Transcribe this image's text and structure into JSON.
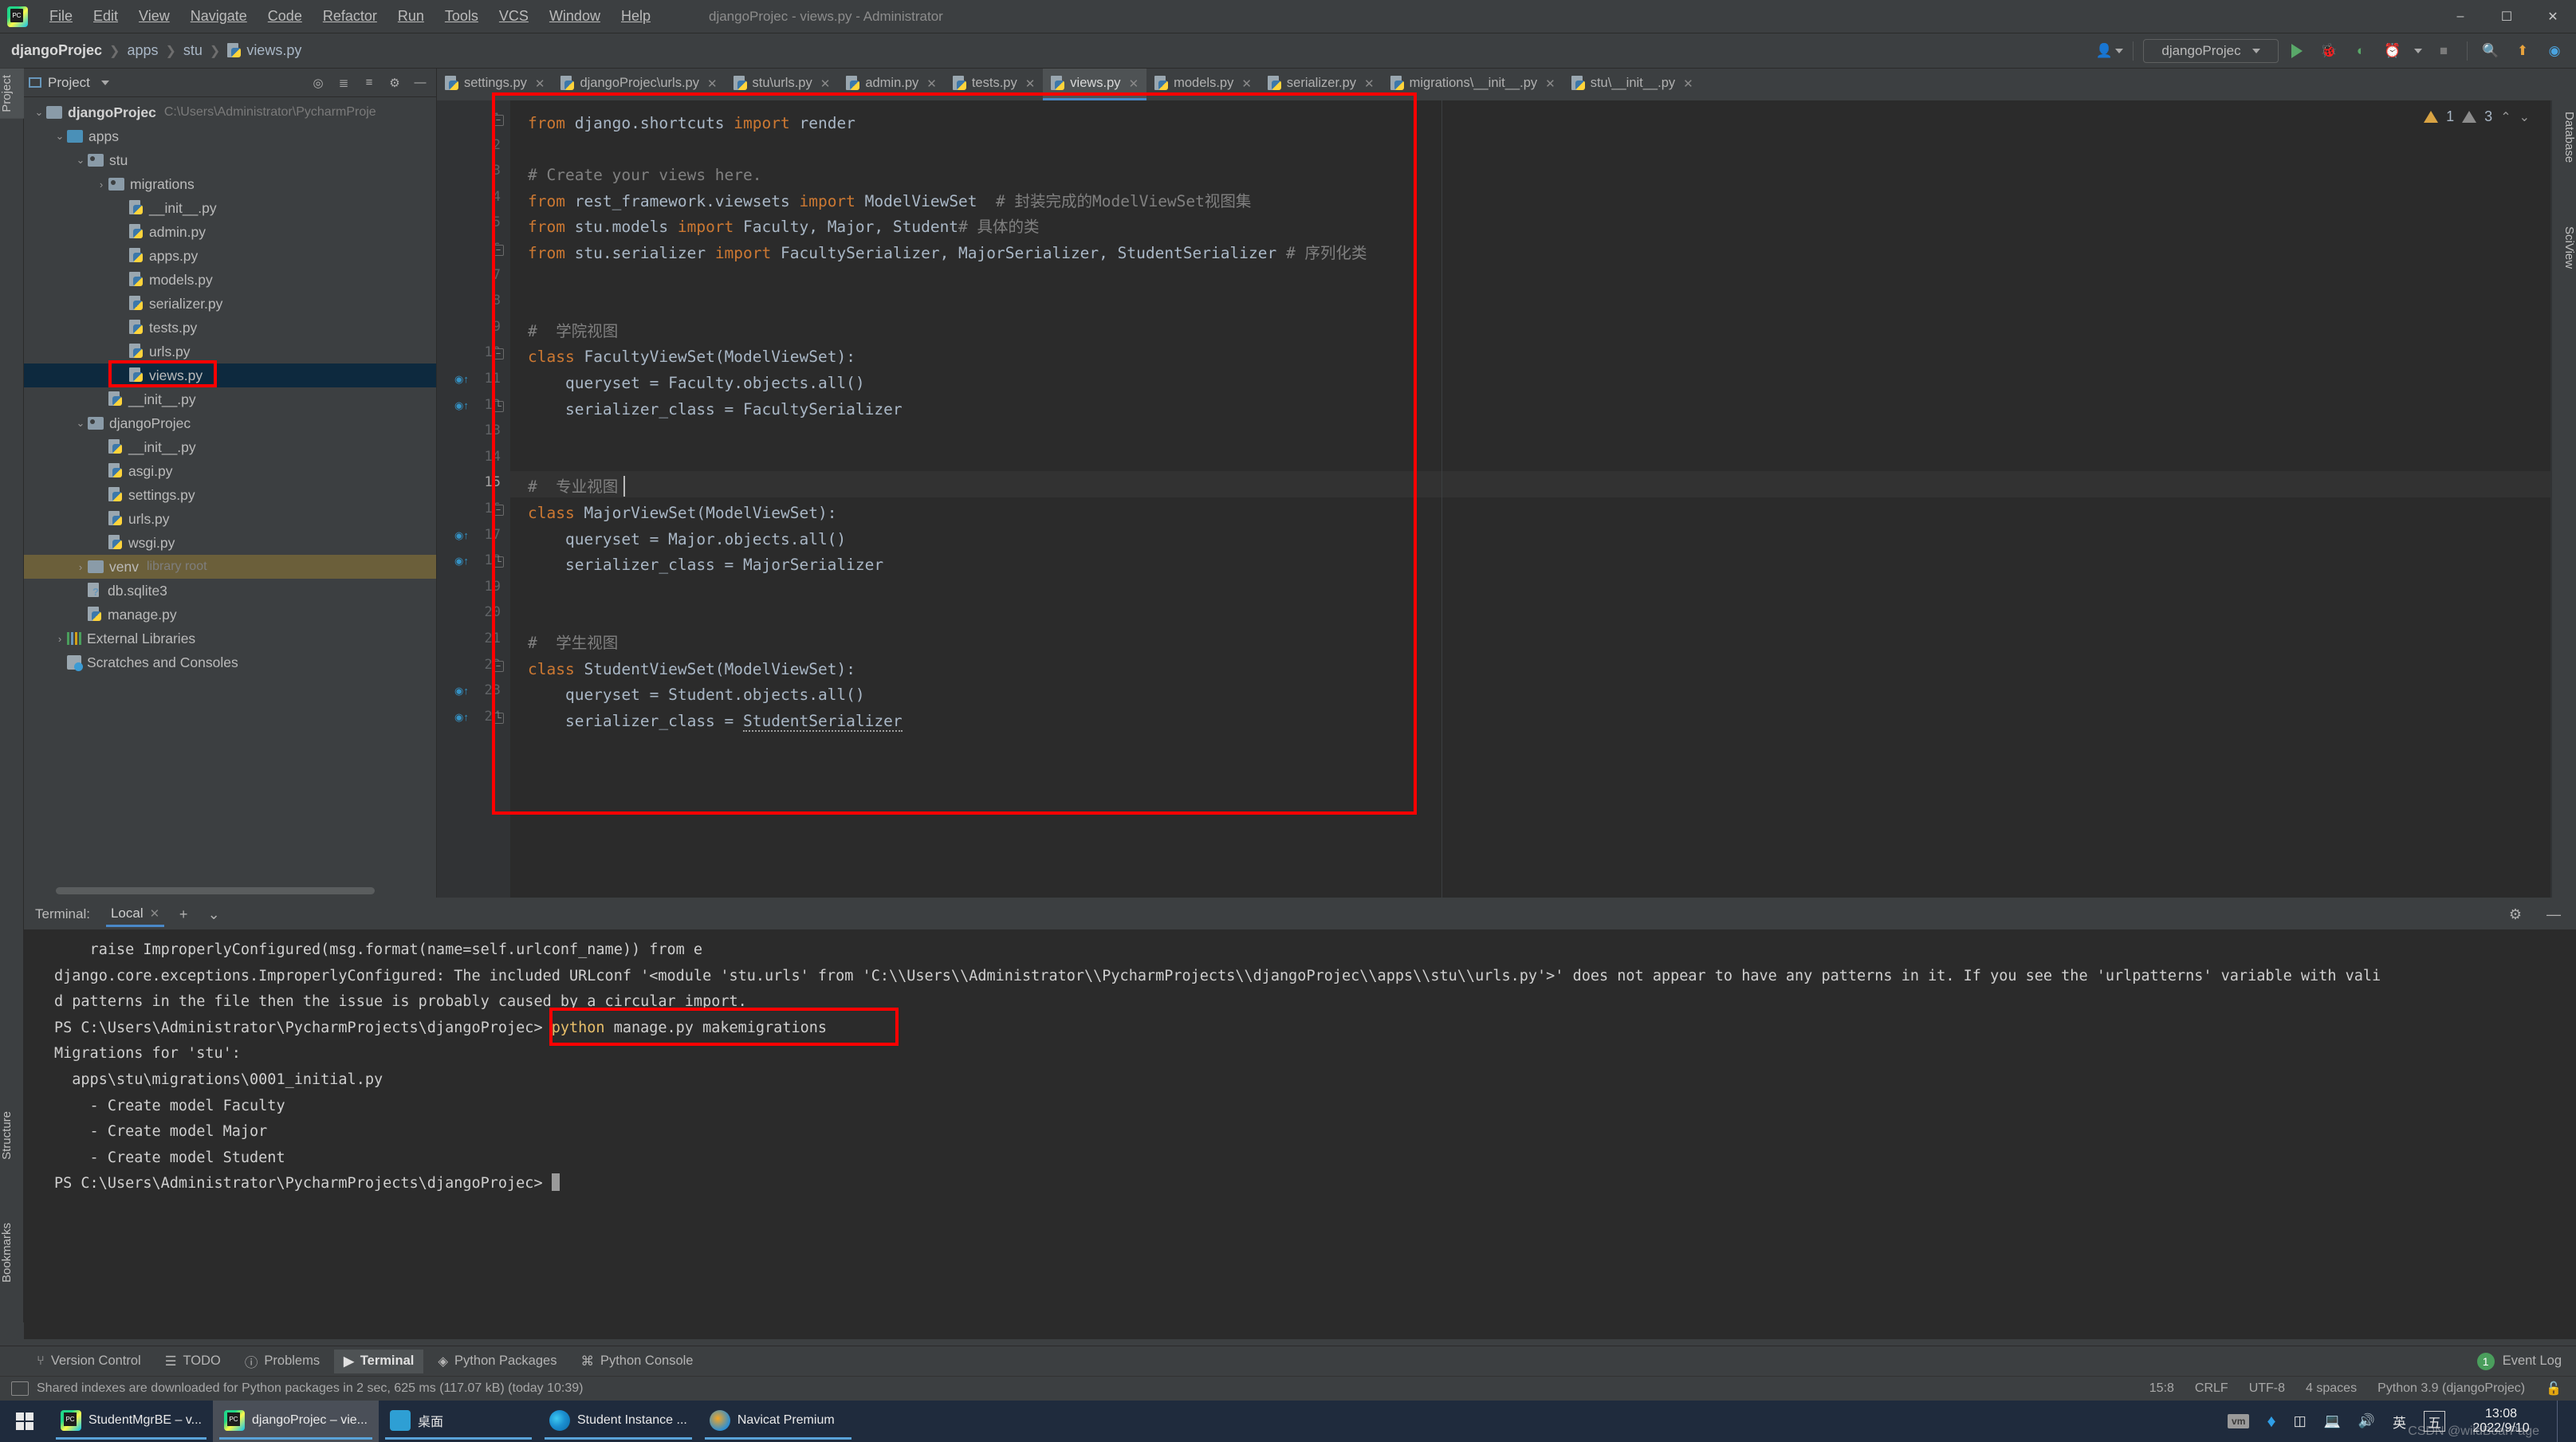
{
  "window": {
    "title": "djangoProjec - views.py - Administrator",
    "app_icon": "pycharm-logo-icon",
    "minimize": "–",
    "maximize": "☐",
    "close": "✕"
  },
  "menubar": [
    {
      "label": "File"
    },
    {
      "label": "Edit"
    },
    {
      "label": "View"
    },
    {
      "label": "Navigate"
    },
    {
      "label": "Code"
    },
    {
      "label": "Refactor"
    },
    {
      "label": "Run"
    },
    {
      "label": "Tools"
    },
    {
      "label": "VCS"
    },
    {
      "label": "Window"
    },
    {
      "label": "Help"
    }
  ],
  "breadcrumb": {
    "items": [
      "djangoProjec",
      "apps",
      "stu",
      "views.py"
    ],
    "separator": "❯"
  },
  "toolbar": {
    "account_icon": "user-account-icon",
    "run_config": "djangoProjec",
    "run_icon": "run-icon",
    "debug_icon": "debug-bug-icon",
    "run_coverage_icon": "run-with-coverage-icon",
    "profile_icon": "profiler-icon",
    "stop_icon": "stop-icon",
    "search_icon": "search-everywhere-icon",
    "updates_icon": "update-available-icon",
    "ide_icon": "ide-features-icon"
  },
  "left_strip": [
    {
      "label": "Project",
      "active": true
    },
    {
      "label": "Structure",
      "active": false
    },
    {
      "label": "Bookmarks",
      "active": false
    }
  ],
  "right_strip": [
    {
      "label": "Database"
    },
    {
      "label": "SciView"
    }
  ],
  "project_panel": {
    "title": "Project",
    "dropdown_icon": "chevron-down-icon",
    "icons": [
      "locate-icon",
      "expand-all-icon",
      "collapse-all-icon",
      "settings-gear-icon",
      "hide-icon"
    ],
    "tree": [
      {
        "depth": 0,
        "arrow": "⌄",
        "kind": "folder",
        "label": "djangoProjec",
        "bold": true,
        "path": "C:\\Users\\Administrator\\PycharmProje",
        "state": "normal"
      },
      {
        "depth": 1,
        "arrow": "⌄",
        "kind": "folder-blue",
        "label": "apps",
        "state": "normal"
      },
      {
        "depth": 2,
        "arrow": "⌄",
        "kind": "folder-mod",
        "label": "stu",
        "state": "normal"
      },
      {
        "depth": 3,
        "arrow": "›",
        "kind": "folder-mod",
        "label": "migrations",
        "state": "normal"
      },
      {
        "depth": 4,
        "arrow": "",
        "kind": "py",
        "label": "__init__.py",
        "state": "normal"
      },
      {
        "depth": 4,
        "arrow": "",
        "kind": "py",
        "label": "admin.py",
        "state": "normal"
      },
      {
        "depth": 4,
        "arrow": "",
        "kind": "py",
        "label": "apps.py",
        "state": "normal"
      },
      {
        "depth": 4,
        "arrow": "",
        "kind": "py",
        "label": "models.py",
        "state": "normal"
      },
      {
        "depth": 4,
        "arrow": "",
        "kind": "py",
        "label": "serializer.py",
        "state": "normal"
      },
      {
        "depth": 4,
        "arrow": "",
        "kind": "py",
        "label": "tests.py",
        "state": "normal"
      },
      {
        "depth": 4,
        "arrow": "",
        "kind": "py",
        "label": "urls.py",
        "state": "normal"
      },
      {
        "depth": 4,
        "arrow": "",
        "kind": "py",
        "label": "views.py",
        "state": "selected"
      },
      {
        "depth": 3,
        "arrow": "",
        "kind": "py",
        "label": "__init__.py",
        "state": "normal"
      },
      {
        "depth": 2,
        "arrow": "⌄",
        "kind": "folder-mod",
        "label": "djangoProjec",
        "state": "normal"
      },
      {
        "depth": 3,
        "arrow": "",
        "kind": "py",
        "label": "__init__.py",
        "state": "normal"
      },
      {
        "depth": 3,
        "arrow": "",
        "kind": "py",
        "label": "asgi.py",
        "state": "normal"
      },
      {
        "depth": 3,
        "arrow": "",
        "kind": "py",
        "label": "settings.py",
        "state": "normal"
      },
      {
        "depth": 3,
        "arrow": "",
        "kind": "py",
        "label": "urls.py",
        "state": "normal"
      },
      {
        "depth": 3,
        "arrow": "",
        "kind": "py",
        "label": "wsgi.py",
        "state": "normal"
      },
      {
        "depth": 2,
        "arrow": "›",
        "kind": "folder",
        "label": "venv",
        "dim": "library root",
        "state": "highlight"
      },
      {
        "depth": 2,
        "arrow": "",
        "kind": "db",
        "label": "db.sqlite3",
        "state": "normal"
      },
      {
        "depth": 2,
        "arrow": "",
        "kind": "py",
        "label": "manage.py",
        "state": "normal"
      },
      {
        "depth": 1,
        "arrow": "›",
        "kind": "lib",
        "label": "External Libraries",
        "state": "normal"
      },
      {
        "depth": 1,
        "arrow": "",
        "kind": "scratch",
        "label": "Scratches and Consoles",
        "state": "normal"
      }
    ]
  },
  "editor_tabs": [
    {
      "label": "settings.py",
      "active": false
    },
    {
      "label": "djangoProjec\\urls.py",
      "active": false
    },
    {
      "label": "stu\\urls.py",
      "active": false
    },
    {
      "label": "admin.py",
      "active": false
    },
    {
      "label": "tests.py",
      "active": false
    },
    {
      "label": "views.py",
      "active": true
    },
    {
      "label": "models.py",
      "active": false
    },
    {
      "label": "serializer.py",
      "active": false
    },
    {
      "label": "migrations\\__init__.py",
      "active": false
    },
    {
      "label": "stu\\__init__.py",
      "active": false
    }
  ],
  "inspections": {
    "warning_count": "1",
    "weak_warning_count": "3",
    "up_icon": "⌃",
    "down_icon": "⌄"
  },
  "code": {
    "cursor_line": 15,
    "lines": [
      {
        "n": 1,
        "fold": "minus",
        "segments": [
          {
            "t": "from ",
            "c": "kw"
          },
          {
            "t": "django.shortcuts ",
            "c": ""
          },
          {
            "t": "import ",
            "c": "kw"
          },
          {
            "t": "render",
            "c": ""
          }
        ]
      },
      {
        "n": 2,
        "fold": "",
        "segments": []
      },
      {
        "n": 3,
        "fold": "",
        "segments": [
          {
            "t": "# Create your views here.",
            "c": "cm"
          }
        ]
      },
      {
        "n": 4,
        "fold": "",
        "segments": [
          {
            "t": "from ",
            "c": "kw"
          },
          {
            "t": "rest_framework.viewsets ",
            "c": ""
          },
          {
            "t": "import ",
            "c": "kw"
          },
          {
            "t": "ModelViewSet  ",
            "c": ""
          },
          {
            "t": "# 封装完成的ModelViewSet视图集",
            "c": "cm"
          }
        ]
      },
      {
        "n": 5,
        "fold": "",
        "segments": [
          {
            "t": "from ",
            "c": "kw"
          },
          {
            "t": "stu.models ",
            "c": ""
          },
          {
            "t": "import ",
            "c": "kw"
          },
          {
            "t": "Faculty, Major, Student",
            "c": ""
          },
          {
            "t": "# 具体的类",
            "c": "cm"
          }
        ]
      },
      {
        "n": 6,
        "fold": "minus",
        "segments": [
          {
            "t": "from ",
            "c": "kw"
          },
          {
            "t": "stu.serializer ",
            "c": ""
          },
          {
            "t": "import ",
            "c": "kw"
          },
          {
            "t": "FacultySerializer, MajorSerializer, StudentSerializer",
            "c": ""
          },
          {
            "t": " # 序列化类",
            "c": "cm"
          }
        ]
      },
      {
        "n": 7,
        "fold": "",
        "segments": []
      },
      {
        "n": 8,
        "fold": "",
        "segments": []
      },
      {
        "n": 9,
        "fold": "",
        "segments": [
          {
            "t": "#  学院视图",
            "c": "cm"
          }
        ]
      },
      {
        "n": 10,
        "fold": "minus",
        "segments": [
          {
            "t": "class ",
            "c": "kw"
          },
          {
            "t": "FacultyViewSet",
            "c": "cls"
          },
          {
            "t": "(ModelViewSet):",
            "c": ""
          }
        ]
      },
      {
        "n": 11,
        "fold": "",
        "gutter": "override",
        "segments": [
          {
            "t": "    queryset = Faculty.objects.all()",
            "c": ""
          }
        ]
      },
      {
        "n": 12,
        "fold": "end",
        "gutter": "override",
        "segments": [
          {
            "t": "    serializer_class = FacultySerializer",
            "c": ""
          }
        ]
      },
      {
        "n": 13,
        "fold": "",
        "segments": []
      },
      {
        "n": 14,
        "fold": "",
        "segments": []
      },
      {
        "n": 15,
        "fold": "",
        "segments": [
          {
            "t": "#  专业视图",
            "c": "cm"
          }
        ]
      },
      {
        "n": 16,
        "fold": "minus",
        "segments": [
          {
            "t": "class ",
            "c": "kw"
          },
          {
            "t": "MajorViewSet",
            "c": "cls"
          },
          {
            "t": "(ModelViewSet):",
            "c": ""
          }
        ]
      },
      {
        "n": 17,
        "fold": "",
        "gutter": "override",
        "segments": [
          {
            "t": "    queryset = Major.objects.all()",
            "c": ""
          }
        ]
      },
      {
        "n": 18,
        "fold": "end",
        "gutter": "override",
        "segments": [
          {
            "t": "    serializer_class = MajorSerializer",
            "c": ""
          }
        ]
      },
      {
        "n": 19,
        "fold": "",
        "segments": []
      },
      {
        "n": 20,
        "fold": "",
        "segments": []
      },
      {
        "n": 21,
        "fold": "",
        "segments": [
          {
            "t": "#  学生视图",
            "c": "cm"
          }
        ]
      },
      {
        "n": 22,
        "fold": "minus",
        "segments": [
          {
            "t": "class ",
            "c": "kw"
          },
          {
            "t": "StudentViewSet",
            "c": "cls"
          },
          {
            "t": "(ModelViewSet):",
            "c": ""
          }
        ]
      },
      {
        "n": 23,
        "fold": "",
        "gutter": "override",
        "segments": [
          {
            "t": "    queryset = Student.objects.all()",
            "c": ""
          }
        ]
      },
      {
        "n": 24,
        "fold": "end",
        "gutter": "override",
        "segments": [
          {
            "t": "    serializer_class = ",
            "c": ""
          },
          {
            "t": "StudentSerializer",
            "c": "wavy"
          }
        ]
      }
    ]
  },
  "terminal": {
    "label": "Terminal:",
    "tab": "Local",
    "tab_close": "✕",
    "add_icon": "+",
    "dropdown_icon": "⌄",
    "settings_icon": "settings-gear-icon",
    "hide_icon": "—",
    "lines": [
      {
        "text": "    raise ImproperlyConfigured(msg.format(name=self.urlconf_name)) from e"
      },
      {
        "text": "django.core.exceptions.ImproperlyConfigured: The included URLconf '<module 'stu.urls' from 'C:\\\\Users\\\\Administrator\\\\PycharmProjects\\\\djangoProjec\\\\apps\\\\stu\\\\urls.py'>' does not appear to have any patterns in it. If you see the 'urlpatterns' variable with vali"
      },
      {
        "text": "d patterns in the file then the issue is probably caused by a circular import."
      },
      {
        "prompt": "PS C:\\Users\\Administrator\\PycharmProjects\\djangoProjec>",
        "cmd_kw": "python",
        "cmd_rest": " manage.py makemigrations"
      },
      {
        "text": "Migrations for 'stu':"
      },
      {
        "text": "  apps\\stu\\migrations\\0001_initial.py"
      },
      {
        "text": "    - Create model Faculty"
      },
      {
        "text": "    - Create model Major"
      },
      {
        "text": "    - Create model Student"
      },
      {
        "prompt2": "PS C:\\Users\\Administrator\\PycharmProjects\\djangoProjec>",
        "caret": true
      }
    ]
  },
  "bottom_tabs": [
    {
      "label": "Version Control",
      "icon": "version-control-icon",
      "active": false
    },
    {
      "label": "TODO",
      "icon": "todo-icon",
      "active": false
    },
    {
      "label": "Problems",
      "icon": "problems-icon",
      "active": false
    },
    {
      "label": "Terminal",
      "icon": "terminal-icon",
      "active": true
    },
    {
      "label": "Python Packages",
      "icon": "python-packages-icon",
      "active": false
    },
    {
      "label": "Python Console",
      "icon": "python-console-icon",
      "active": false
    }
  ],
  "event_log": {
    "count": "1",
    "label": "Event Log"
  },
  "statusbar": {
    "message": "Shared indexes are downloaded for Python packages in 2 sec, 625 ms (117.07 kB) (today 10:39)",
    "caret_position": "15:8",
    "line_separator": "CRLF",
    "encoding": "UTF-8",
    "indent": "4 spaces",
    "interpreter": "Python 3.9 (djangoProjec)",
    "lock_icon": "lock-icon"
  },
  "taskbar": {
    "start_icon": "windows-start-icon",
    "apps": [
      {
        "label": "StudentMgrBE – v...",
        "icon": "pycharm",
        "active": false
      },
      {
        "label": "djangoProjec – vie...",
        "icon": "pycharm",
        "active": true
      },
      {
        "label": "桌面",
        "icon": "desktop",
        "active": false
      },
      {
        "label": "Student Instance ...",
        "icon": "edge",
        "active": false
      },
      {
        "label": "Navicat Premium",
        "icon": "navicat",
        "active": false
      }
    ],
    "tray": [
      "vm-icon",
      "bluetooth-icon",
      "usb-icon",
      "network-icon",
      "volume-icon",
      "英",
      "五"
    ],
    "clock_time": "13:08",
    "clock_date": "2022/9/10",
    "watermark": "CSDN @wildBoarPage"
  },
  "annotations": {
    "box1": "views-py-tree-highlight",
    "box2": "editor-code-highlight",
    "box3": "terminal-command-highlight"
  }
}
